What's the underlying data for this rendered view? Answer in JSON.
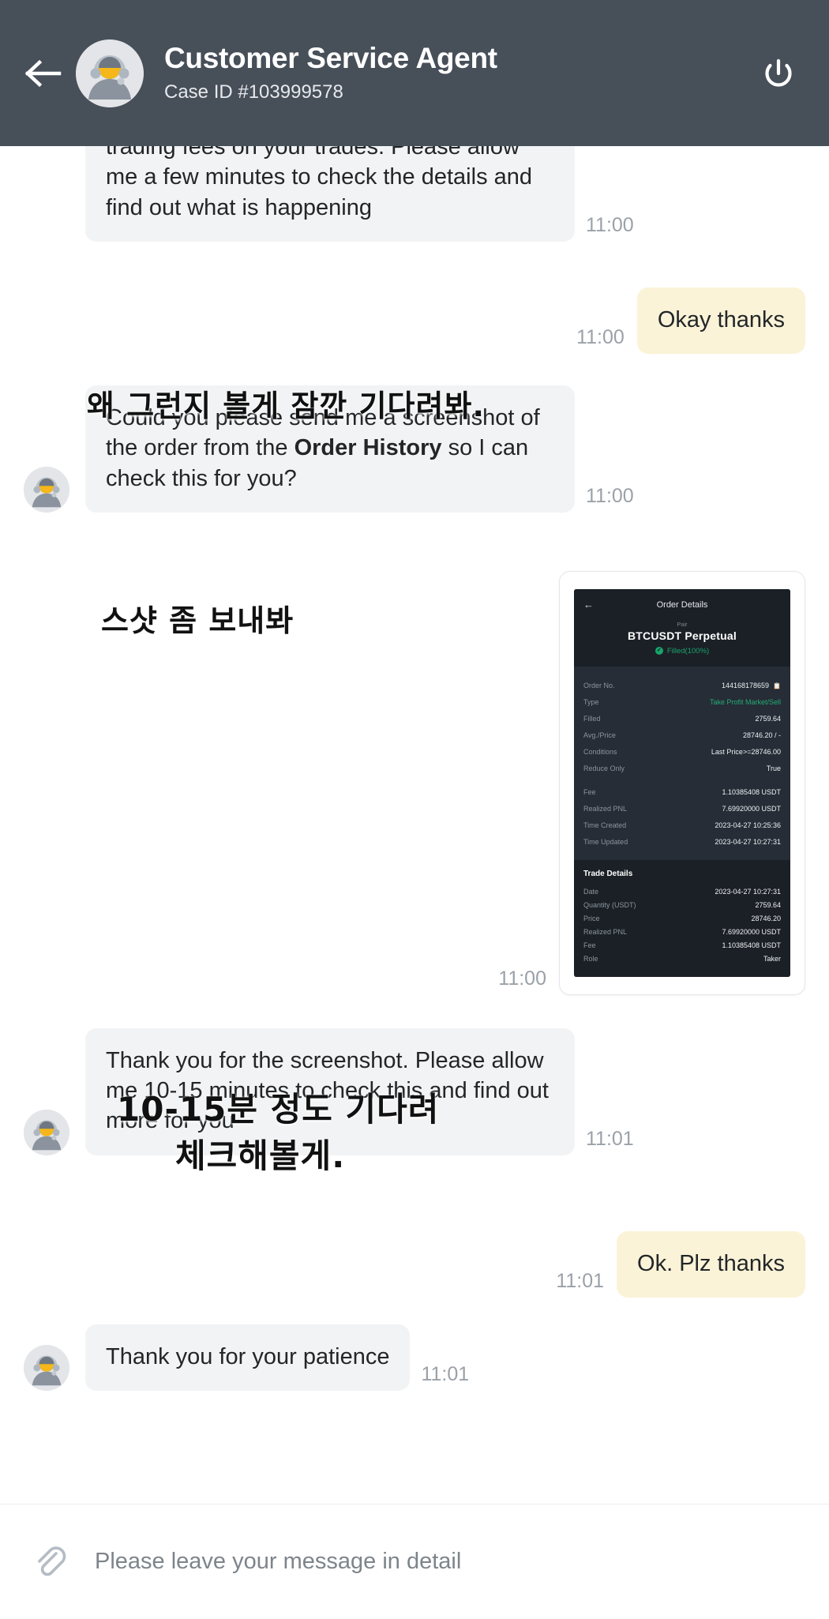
{
  "header": {
    "back_icon": "arrow-left-icon",
    "avatar_icon": "agent-headset-avatar",
    "title": "Customer Service Agent",
    "case_id": "Case ID #103999578",
    "power_icon": "power-icon",
    "bg_color": "#474f59"
  },
  "colors": {
    "agent_bubble": "#f2f3f4",
    "user_bubble": "#fbf3d7",
    "timestamp": "#9ba1a8",
    "accent_green": "#1aa36c"
  },
  "messages": [
    {
      "sender": "agent",
      "text": "trading fees on your trades. Please allow me a few minutes to check the details and find out what is happening",
      "time": "11:00",
      "annotation": "왜 그런지 볼게 잠깐 기다려봐."
    },
    {
      "sender": "user",
      "text": "Okay thanks",
      "time": "11:00"
    },
    {
      "sender": "agent",
      "text_before": "Could you please send me a screenshot of the order from the ",
      "text_bold": "Order History",
      "text_after": " so I can check this for you?",
      "time": "11:00",
      "annotation": "스샷 좀 보내봐"
    },
    {
      "sender": "user",
      "type": "attachment",
      "time": "11:00"
    },
    {
      "sender": "agent",
      "text": "Thank you for the screenshot. Please allow me 10-15 minutes to check this and find out more for you",
      "time": "11:01",
      "annotation_line1": "10-15분 정도 기다려",
      "annotation_line2": "체크해볼게."
    },
    {
      "sender": "user",
      "text": "Ok. Plz thanks",
      "time": "11:01"
    },
    {
      "sender": "agent",
      "text": "Thank you for your patience",
      "time": "11:01"
    }
  ],
  "attachment": {
    "nav": {
      "back_icon": "arrow-left-icon",
      "title": "Order Details"
    },
    "pair_label": "Pair",
    "pair": "BTCUSDT Perpetual",
    "status": "Filled(100%)",
    "order_rows": [
      {
        "key": "Order No.",
        "value": "144168178659",
        "copy": true
      },
      {
        "key": "Type",
        "value": "Take Profit Market/Sell",
        "green": true
      },
      {
        "key": "Filled",
        "value": "2759.64"
      },
      {
        "key": "Avg./Price",
        "value": "28746.20 / -"
      },
      {
        "key": "Conditions",
        "value": "Last Price>=28746.00"
      },
      {
        "key": "Reduce Only",
        "value": "True"
      }
    ],
    "order_rows2": [
      {
        "key": "Fee",
        "value": "1.10385408 USDT"
      },
      {
        "key": "Realized PNL",
        "value": "7.69920000 USDT"
      },
      {
        "key": "Time Created",
        "value": "2023-04-27 10:25:36"
      },
      {
        "key": "Time Updated",
        "value": "2023-04-27 10:27:31"
      }
    ],
    "trade_title": "Trade Details",
    "trade_rows": [
      {
        "key": "Date",
        "value": "2023-04-27 10:27:31"
      },
      {
        "key": "Quantity (USDT)",
        "value": "2759.64"
      },
      {
        "key": "Price",
        "value": "28746.20"
      },
      {
        "key": "Realized PNL",
        "value": "7.69920000 USDT"
      },
      {
        "key": "Fee",
        "value": "1.10385408 USDT"
      },
      {
        "key": "Role",
        "value": "Taker"
      }
    ]
  },
  "input": {
    "clip_icon": "paperclip-icon",
    "placeholder": "Please leave your message in detail",
    "value": ""
  }
}
